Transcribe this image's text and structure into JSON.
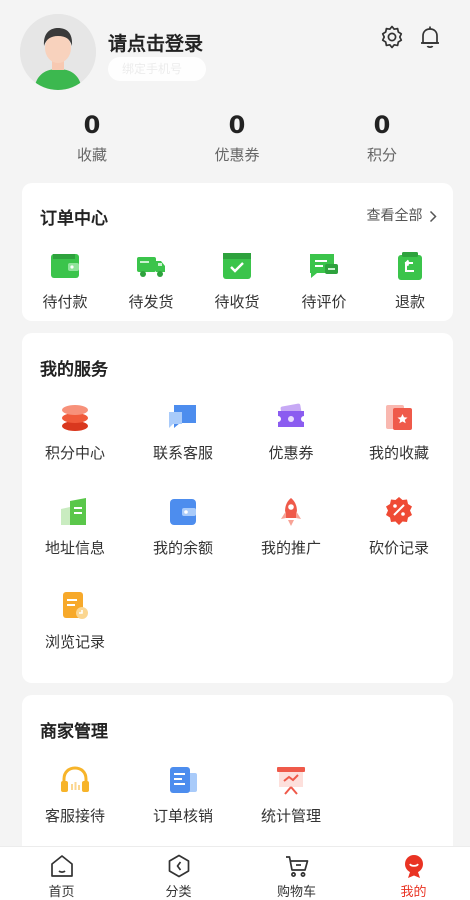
{
  "profile": {
    "login_title": "请点击登录",
    "login_sub": "绑定手机号"
  },
  "header_icons": [
    "settings-gear-icon",
    "bell-icon"
  ],
  "stats": [
    {
      "value": "0",
      "label": "收藏"
    },
    {
      "value": "0",
      "label": "优惠券"
    },
    {
      "value": "0",
      "label": "积分"
    }
  ],
  "orders": {
    "title": "订单中心",
    "view_all": "查看全部",
    "items": [
      {
        "label": "待付款",
        "icon": "wallet-icon"
      },
      {
        "label": "待发货",
        "icon": "truck-icon"
      },
      {
        "label": "待收货",
        "icon": "package-icon"
      },
      {
        "label": "待评价",
        "icon": "comment-icon"
      },
      {
        "label": "退款",
        "icon": "refund-bag-icon"
      }
    ]
  },
  "services": {
    "title": "我的服务",
    "items": [
      {
        "label": "积分中心",
        "icon": "points-stack-icon"
      },
      {
        "label": "联系客服",
        "icon": "chat-icon"
      },
      {
        "label": "优惠券",
        "icon": "coupon-icon"
      },
      {
        "label": "我的收藏",
        "icon": "favorites-icon"
      },
      {
        "label": "地址信息",
        "icon": "address-icon"
      },
      {
        "label": "我的余额",
        "icon": "balance-wallet-icon"
      },
      {
        "label": "我的推广",
        "icon": "rocket-icon"
      },
      {
        "label": "砍价记录",
        "icon": "discount-badge-icon"
      },
      {
        "label": "浏览记录",
        "icon": "history-icon"
      }
    ]
  },
  "merchant": {
    "title": "商家管理",
    "items": [
      {
        "label": "客服接待",
        "icon": "headset-icon"
      },
      {
        "label": "订单核销",
        "icon": "verify-order-icon"
      },
      {
        "label": "统计管理",
        "icon": "statistics-icon"
      }
    ]
  },
  "tabbar": [
    {
      "label": "首页",
      "icon": "home-icon"
    },
    {
      "label": "分类",
      "icon": "category-icon"
    },
    {
      "label": "购物车",
      "icon": "cart-icon"
    },
    {
      "label": "我的",
      "icon": "user-icon",
      "active": true
    }
  ],
  "colors": {
    "accent": "#e93323",
    "order_green": "#3bc44b",
    "background": "#f4f4f4"
  }
}
